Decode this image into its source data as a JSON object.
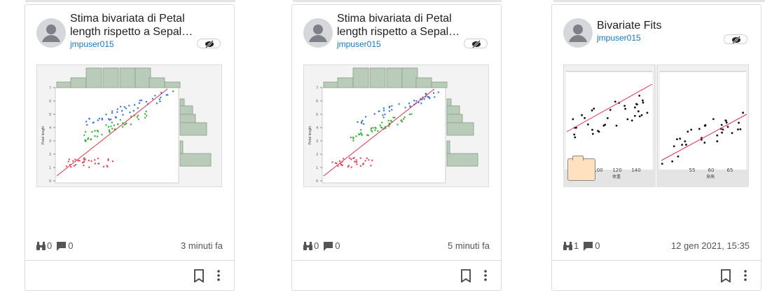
{
  "cards": [
    {
      "title": "Stima bivariata di Petal length rispetto a Sepal…",
      "author": "jmpuser015",
      "views": "0",
      "comments": "0",
      "time": "3 minuti fa",
      "thumb_type": "scatter-marginal",
      "y_axis_label": "Petal length",
      "y_ticks": [
        "0",
        "1",
        "2",
        "3",
        "4",
        "5",
        "6",
        "7"
      ]
    },
    {
      "title": "Stima bivariata di Petal length rispetto a Sepal…",
      "author": "jmpuser015",
      "views": "0",
      "comments": "0",
      "time": "5 minuti fa",
      "thumb_type": "scatter-marginal",
      "y_axis_label": "Petal length",
      "y_ticks": [
        "0",
        "1",
        "2",
        "3",
        "4",
        "5",
        "6",
        "7"
      ]
    },
    {
      "title": "Bivariate Fits",
      "author": "jmpuser015",
      "views": "1",
      "comments": "0",
      "time": "12 gen 2021, 15:35",
      "thumb_type": "two-fits",
      "left_x_label": "体重",
      "left_x_ticks": [
        "100",
        "120",
        "140"
      ],
      "right_x_label": "身高",
      "right_x_ticks": [
        "55",
        "60",
        "65"
      ]
    }
  ],
  "icons": {
    "avatar": "user-avatar-icon",
    "hidden": "eye-off-icon",
    "views": "binoculars-icon",
    "comments": "comment-icon",
    "bookmark": "bookmark-icon",
    "more": "more-vertical-icon",
    "folder": "folder-icon"
  },
  "colors": {
    "link": "#1c76b8",
    "series_red": "#d94a5a",
    "series_green": "#3faa3f",
    "series_blue": "#3b6fd6",
    "fit_line": "#d9334b",
    "histogram": "#b9cbb9"
  }
}
